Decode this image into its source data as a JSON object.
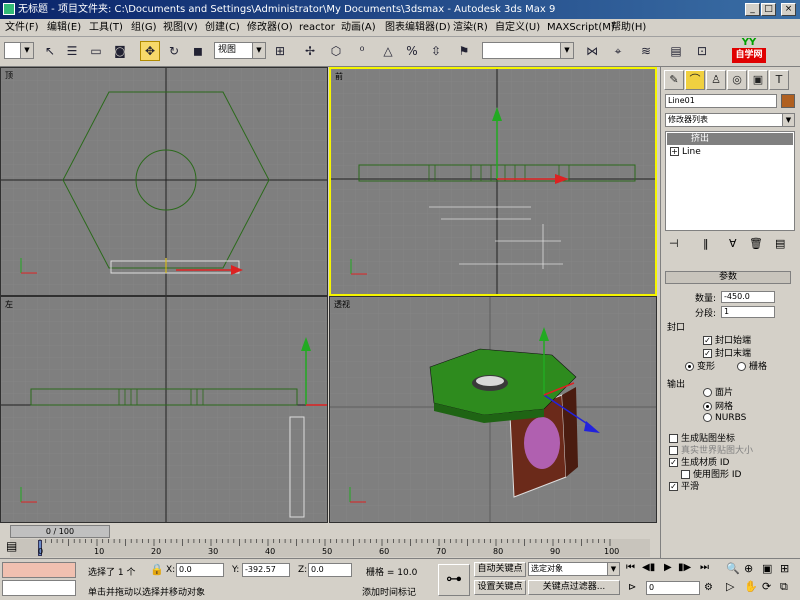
{
  "window": {
    "title": "无标题 - 项目文件夹: C:\\Documents and Settings\\Administrator\\My Documents\\3dsmax - Autodesk 3ds Max 9",
    "min": "_",
    "max": "□",
    "close": "×"
  },
  "menu": [
    "文件(F)",
    "编辑(E)",
    "工具(T)",
    "组(G)",
    "视图(V)",
    "创建(C)",
    "修改器(O)",
    "reactor",
    "动画(A)",
    "图表编辑器(D)",
    "渲染(R)",
    "自定义(U)",
    "MAXScript(M)",
    "帮助(H)"
  ],
  "toolbar": {
    "selection_filter": "",
    "coord_system": "视图",
    "named_selection": ""
  },
  "watermark": {
    "top": "YY",
    "bottom": "自学网"
  },
  "viewports": [
    {
      "label": "顶"
    },
    {
      "label": "前"
    },
    {
      "label": "左"
    },
    {
      "label": "透视"
    }
  ],
  "command_panel": {
    "object_name": "Line01",
    "modifier_list": "修改器列表",
    "stack": [
      {
        "label": "挤出",
        "selected": true
      },
      {
        "label": "Line",
        "selected": false
      }
    ],
    "params_title": "参数",
    "amount_label": "数量:",
    "amount_value": "-450.0",
    "segments_label": "分段:",
    "segments_value": "1",
    "capping_title": "封口",
    "cap_start": "封口始端",
    "cap_end": "封口末端",
    "morph": "变形",
    "grid": "栅格",
    "output_title": "输出",
    "patch": "面片",
    "mesh": "网格",
    "nurbs": "NURBS",
    "gen_mapping": "生成贴图坐标",
    "real_world": "真实世界贴图大小",
    "gen_mat_ids": "生成材质 ID",
    "use_shape_ids": "使用图形 ID",
    "smooth": "平滑"
  },
  "timeline": {
    "frame_indicator": "0 / 100",
    "ticks": [
      "0",
      "10",
      "20",
      "30",
      "40",
      "50",
      "60",
      "70",
      "80",
      "90",
      "100"
    ]
  },
  "status": {
    "selected": "选择了 1 个",
    "x_label": "X:",
    "x_value": "0.0",
    "y_label": "Y:",
    "y_value": "-392.57",
    "z_label": "Z:",
    "z_value": "0.0",
    "grid": "栅格 = 10.0",
    "auto_key": "自动关键点",
    "set_key": "设置关键点",
    "key_filter_sel": "选定对象",
    "key_filters": "关键点过滤器...",
    "prompt": "单击并拖动以选择并移动对象",
    "add_time_tag": "添加时间标记",
    "frame_value": "0"
  },
  "colors": {
    "viewport_bg": "#7f7f7f",
    "active_border": "#f5f500",
    "object_green": "#2e8b1e",
    "object_brown": "#6b2a1a",
    "object_purple": "#b060b0"
  }
}
